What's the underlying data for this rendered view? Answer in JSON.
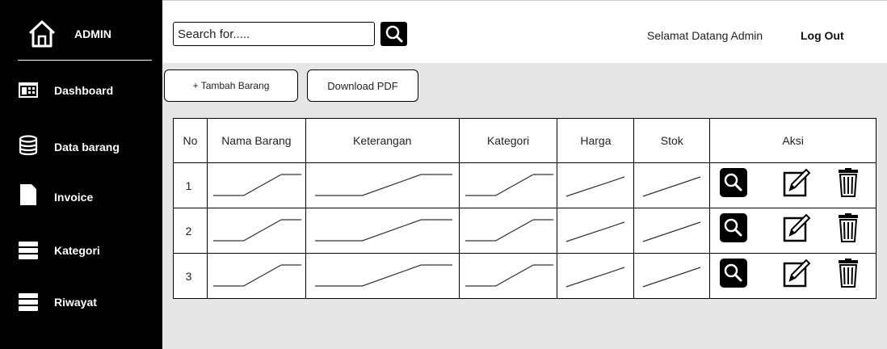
{
  "sidebar": {
    "brand": {
      "label": "ADMIN",
      "icon": "home-icon"
    },
    "items": [
      {
        "label": "Dashboard",
        "icon": "dashboard-icon"
      },
      {
        "label": "Data barang",
        "icon": "database-icon"
      },
      {
        "label": "Invoice",
        "icon": "document-icon"
      },
      {
        "label": "Kategori",
        "icon": "list-icon"
      },
      {
        "label": "Riwayat",
        "icon": "list-icon"
      }
    ]
  },
  "topbar": {
    "search": {
      "placeholder": "Search for.....",
      "value": "",
      "icon": "search-icon"
    },
    "welcome": "Selamat Datang Admin",
    "logout": "Log Out"
  },
  "toolbar": {
    "add_label": "+ Tambah Barang",
    "pdf_label": "Download PDF"
  },
  "table": {
    "columns": [
      "No",
      "Nama Barang",
      "Keterangan",
      "Kategori",
      "Harga",
      "Stok",
      "Aksi"
    ],
    "rows": [
      {
        "no": "1"
      },
      {
        "no": "2"
      },
      {
        "no": "3"
      }
    ],
    "action_icons": [
      "search-icon",
      "edit-icon",
      "trash-icon"
    ]
  },
  "colors": {
    "sidebar_bg": "#000000",
    "content_bg": "#e6e6e6",
    "text": "#222222"
  }
}
